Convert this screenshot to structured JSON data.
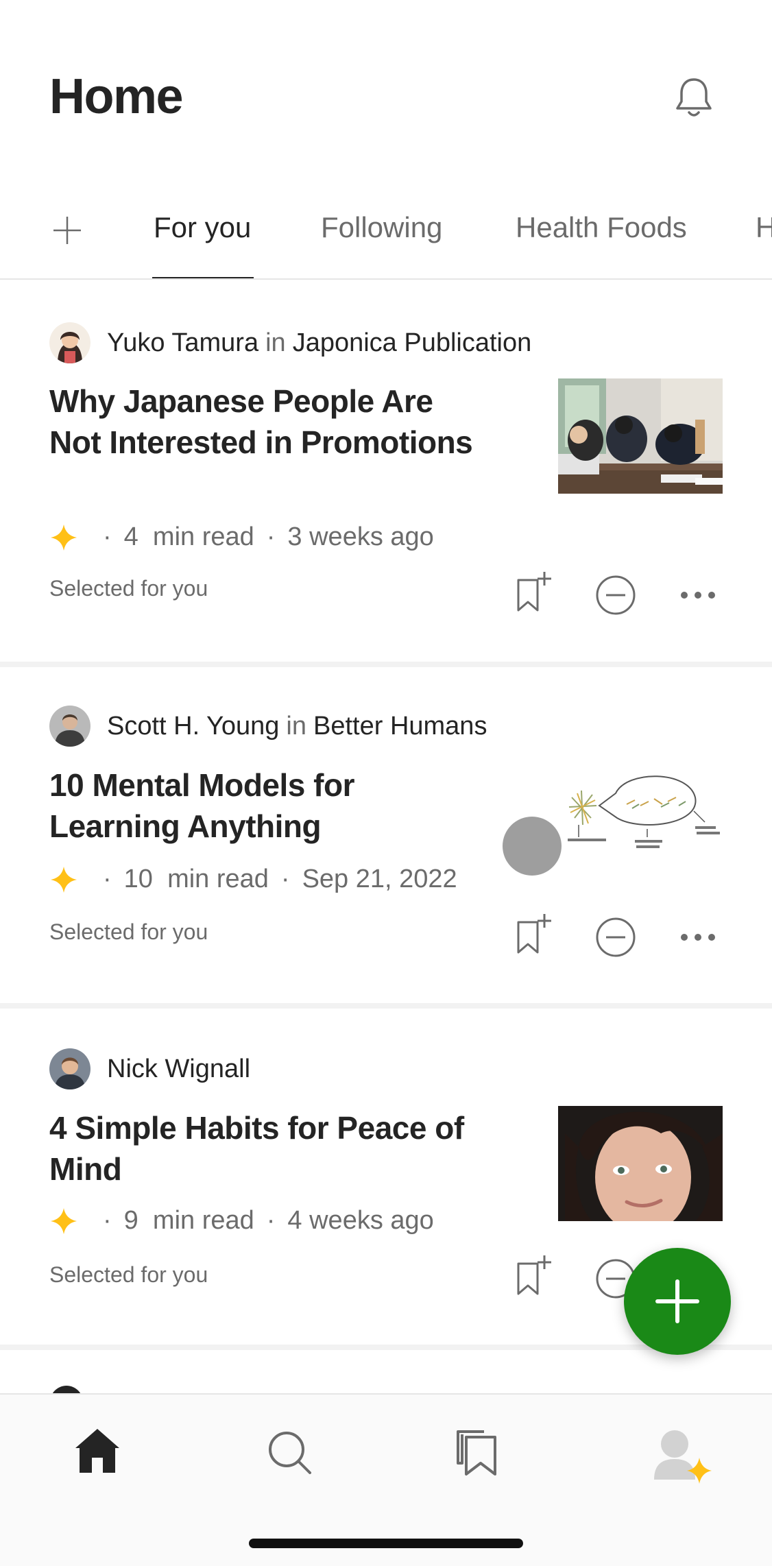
{
  "header": {
    "title": "Home"
  },
  "tabs": [
    "For you",
    "Following",
    "Health Foods",
    "H"
  ],
  "articles": [
    {
      "author": "Yuko Tamura",
      "in_word": "in",
      "publication": "Japonica Publication",
      "title": "Why Japanese People Are Not Interested in Promotions",
      "read_number": "4",
      "read_unit": "min read",
      "age": "3 weeks ago",
      "reason": "Selected for you"
    },
    {
      "author": "Scott H. Young",
      "in_word": "in",
      "publication": "Better Humans",
      "title": "10 Mental Models for Learning Anything",
      "read_number": "10",
      "read_unit": "min read",
      "age": "Sep 21, 2022",
      "reason": "Selected for you"
    },
    {
      "author": "Nick Wignall",
      "title": "4 Simple Habits for Peace of Mind",
      "read_number": "9",
      "read_unit": "min read",
      "age": "4 weeks ago",
      "reason": "Selected for you"
    }
  ],
  "meta_separator": "·",
  "icons": {
    "notifications": "bell-icon",
    "add_topic": "plus-icon",
    "member_only": "star-icon",
    "save": "bookmark-add-icon",
    "show_less": "minus-circle-icon",
    "more": "more-horizontal-icon",
    "write": "plus-icon",
    "nav_home": "home-icon",
    "nav_search": "search-icon",
    "nav_library": "bookmarks-icon",
    "nav_profile": "profile-icon"
  },
  "colors": {
    "accent_green": "#1a8917",
    "star_yellow": "#ffc017",
    "text_primary": "#242424",
    "text_secondary": "#6b6b6b"
  }
}
